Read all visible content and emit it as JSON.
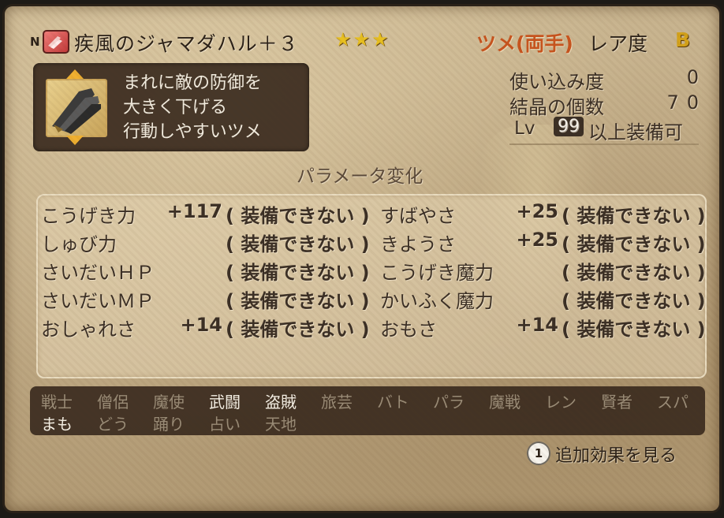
{
  "header": {
    "badge": "N",
    "name": "疾風のジャマダハル＋３",
    "stars": "★★★",
    "category": "ツメ(両手)",
    "rarity_label": "レア度",
    "rarity": "B"
  },
  "description": {
    "lines": [
      "まれに敵の防御を",
      "大きく下げる",
      "行動しやすいツメ"
    ]
  },
  "info": {
    "usage_label": "使い込み度",
    "usage_value": "0",
    "crystal_label": "結晶の個数",
    "crystal_value": "70",
    "lv_tag": "Lv",
    "lv_value": "99",
    "lv_text": "以上装備可"
  },
  "params_title": "パラメータ変化",
  "params": [
    {
      "name": "こうげき力",
      "val": "+117",
      "status": "( 装備できない )",
      "name2": "すばやさ",
      "val2": "+25",
      "status2": "( 装備できない )"
    },
    {
      "name": "しゅび力",
      "val": "",
      "status": "( 装備できない )",
      "name2": "きようさ",
      "val2": "+25",
      "status2": "( 装備できない )"
    },
    {
      "name": "さいだいＨＰ",
      "val": "",
      "status": "( 装備できない )",
      "name2": "こうげき魔力",
      "val2": "",
      "status2": "( 装備できない )"
    },
    {
      "name": "さいだいＭＰ",
      "val": "",
      "status": "( 装備できない )",
      "name2": "かいふく魔力",
      "val2": "",
      "status2": "( 装備できない )"
    },
    {
      "name": "おしゃれさ",
      "val": "+14",
      "status": "( 装備できない )",
      "name2": "おもさ",
      "val2": "+14",
      "status2": "( 装備できない )"
    }
  ],
  "jobs_row1": [
    {
      "label": "戦士",
      "active": false
    },
    {
      "label": "僧侶",
      "active": false
    },
    {
      "label": "魔使",
      "active": false
    },
    {
      "label": "武闘",
      "active": true
    },
    {
      "label": "盗賊",
      "active": true
    },
    {
      "label": "旅芸",
      "active": false
    },
    {
      "label": "バト",
      "active": false
    },
    {
      "label": "パラ",
      "active": false
    },
    {
      "label": "魔戦",
      "active": false
    },
    {
      "label": "レン",
      "active": false
    },
    {
      "label": "賢者",
      "active": false
    },
    {
      "label": "スパ",
      "active": false
    }
  ],
  "jobs_row2": [
    {
      "label": "まも",
      "active": true
    },
    {
      "label": "どう",
      "active": false
    },
    {
      "label": "踊り",
      "active": false
    },
    {
      "label": "占い",
      "active": false
    },
    {
      "label": "天地",
      "active": false
    }
  ],
  "more": {
    "button": "1",
    "label": "追加効果を見る"
  },
  "colors": {
    "category": "#c8541e",
    "stars": "#e8c020",
    "rarity": "#d4a21a",
    "panel": "#c2ad88",
    "dark_box": "#3a2a1e"
  }
}
